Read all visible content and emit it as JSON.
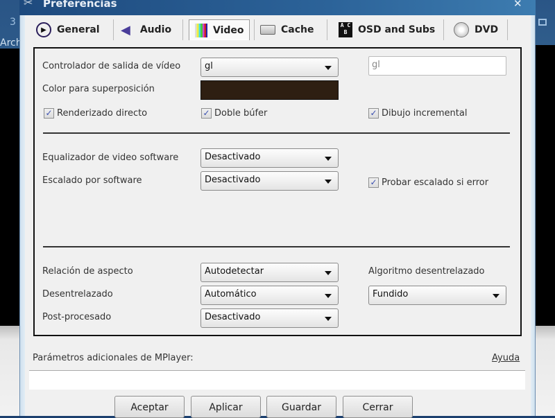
{
  "background_window": {
    "icon_text": "3",
    "menu_text": "Arch"
  },
  "dialog": {
    "title": "Preferencias",
    "close_glyph": "✕"
  },
  "tabs": [
    {
      "label": "General",
      "icon": "play-circle-icon"
    },
    {
      "label": "Audio",
      "icon": "speaker-icon"
    },
    {
      "label": "Video",
      "icon": "color-bars-icon",
      "selected": true
    },
    {
      "label": "Cache",
      "icon": "drive-icon"
    },
    {
      "label": "OSD and Subs",
      "icon": "abc-icon"
    },
    {
      "label": "DVD",
      "icon": "dvd-icon"
    }
  ],
  "video": {
    "output_driver": {
      "label": "Controlador de salida de vídeo",
      "value": "gl",
      "custom_value": "gl"
    },
    "overlay_color": {
      "label": "Color para superposición",
      "value": "#2e1f12"
    },
    "direct_render": {
      "label": "Renderizado directo",
      "checked": true
    },
    "double_buffer": {
      "label": "Doble búfer",
      "checked": true
    },
    "incremental_draw": {
      "label": "Dibujo incremental",
      "checked": true
    },
    "software_eq": {
      "label": "Equalizador de video software",
      "value": "Desactivado"
    },
    "software_scaling": {
      "label": "Escalado por software",
      "value": "Desactivado"
    },
    "try_scaling": {
      "label": "Probar escalado si error",
      "checked": true
    },
    "aspect": {
      "label": "Relación de aspecto",
      "value": "Autodetectar"
    },
    "deinterlace": {
      "label": "Desentrelazado",
      "value": "Automático"
    },
    "postprocess": {
      "label": "Post-procesado",
      "value": "Desactivado"
    },
    "deinterlace_algo": {
      "label": "Algoritmo desentrelazado",
      "value": "Fundido"
    }
  },
  "extra": {
    "label": "Parámetros adicionales de MPlayer:",
    "help": "Ayuda",
    "value": ""
  },
  "buttons": {
    "accept": "Aceptar",
    "apply": "Aplicar",
    "save": "Guardar",
    "close": "Cerrar"
  },
  "check_glyph": "✓"
}
